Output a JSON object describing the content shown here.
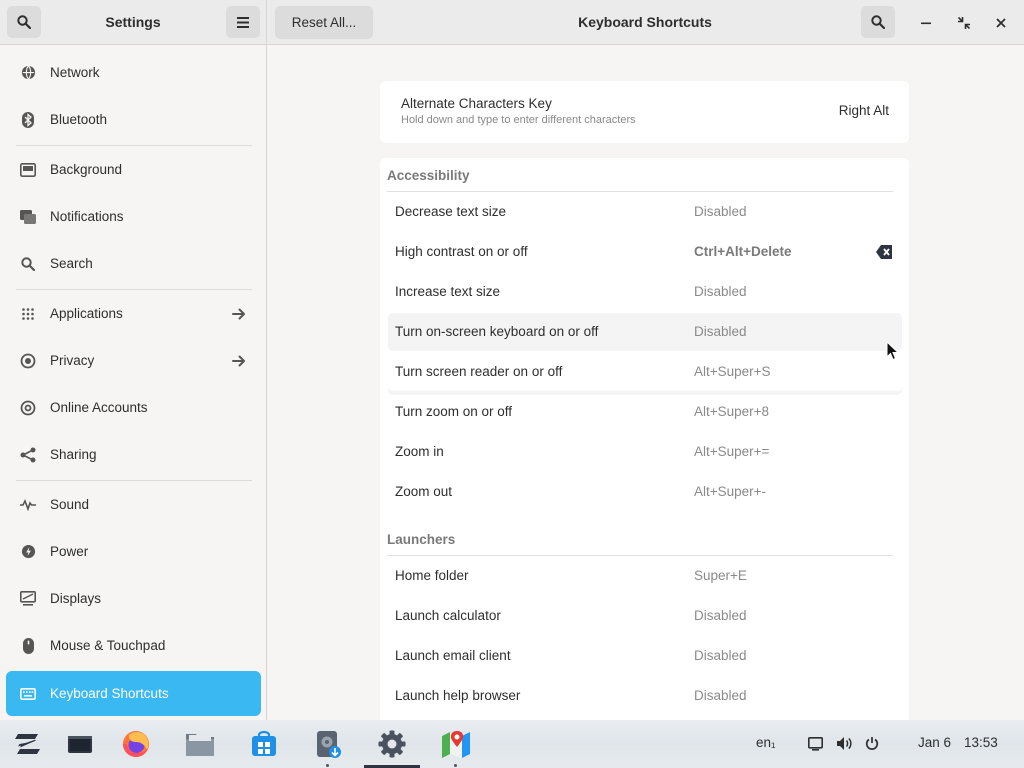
{
  "header": {
    "sidebar_title": "Settings",
    "reset_label": "Reset All...",
    "page_title": "Keyboard Shortcuts"
  },
  "sidebar": {
    "items": [
      {
        "label": "Network",
        "icon": "network-icon"
      },
      {
        "label": "Bluetooth",
        "icon": "bluetooth-icon"
      },
      {
        "label": "Background",
        "icon": "background-icon"
      },
      {
        "label": "Notifications",
        "icon": "notifications-icon"
      },
      {
        "label": "Search",
        "icon": "search-icon"
      },
      {
        "label": "Applications",
        "icon": "applications-icon"
      },
      {
        "label": "Privacy",
        "icon": "privacy-icon"
      },
      {
        "label": "Online Accounts",
        "icon": "online-accounts-icon"
      },
      {
        "label": "Sharing",
        "icon": "sharing-icon"
      },
      {
        "label": "Sound",
        "icon": "sound-icon"
      },
      {
        "label": "Power",
        "icon": "power-icon"
      },
      {
        "label": "Displays",
        "icon": "displays-icon"
      },
      {
        "label": "Mouse & Touchpad",
        "icon": "mouse-icon"
      },
      {
        "label": "Keyboard Shortcuts",
        "icon": "keyboard-icon"
      }
    ],
    "active": "Keyboard Shortcuts",
    "active_color": "#3ab8f2"
  },
  "alternate_key": {
    "title": "Alternate Characters Key",
    "subtitle": "Hold down and type to enter different characters",
    "value": "Right Alt"
  },
  "sections": [
    {
      "title": "Accessibility",
      "rows": [
        {
          "name": "Decrease text size",
          "accel": "Disabled"
        },
        {
          "name": "High contrast on or off",
          "accel": "Ctrl+Alt+Delete"
        },
        {
          "name": "Increase text size",
          "accel": "Disabled"
        },
        {
          "name": "Turn on-screen keyboard on or off",
          "accel": "Disabled"
        },
        {
          "name": "Turn screen reader on or off",
          "accel": "Alt+Super+S"
        },
        {
          "name": "Turn zoom on or off",
          "accel": "Alt+Super+8"
        },
        {
          "name": "Zoom in",
          "accel": "Alt+Super+="
        },
        {
          "name": "Zoom out",
          "accel": "Alt+Super+-"
        }
      ]
    },
    {
      "title": "Launchers",
      "rows": [
        {
          "name": "Home folder",
          "accel": "Super+E"
        },
        {
          "name": "Launch calculator",
          "accel": "Disabled"
        },
        {
          "name": "Launch email client",
          "accel": "Disabled"
        },
        {
          "name": "Launch help browser",
          "accel": "Disabled"
        }
      ]
    }
  ],
  "taskbar": {
    "apps": [
      "zorin-menu-icon",
      "files-window-icon",
      "firefox-icon",
      "file-manager-icon",
      "software-store-icon",
      "drive-installer-icon",
      "settings-icon",
      "maps-icon"
    ],
    "keyboard_layout": "en₁",
    "date": "Jan 6",
    "time": "13:53"
  }
}
